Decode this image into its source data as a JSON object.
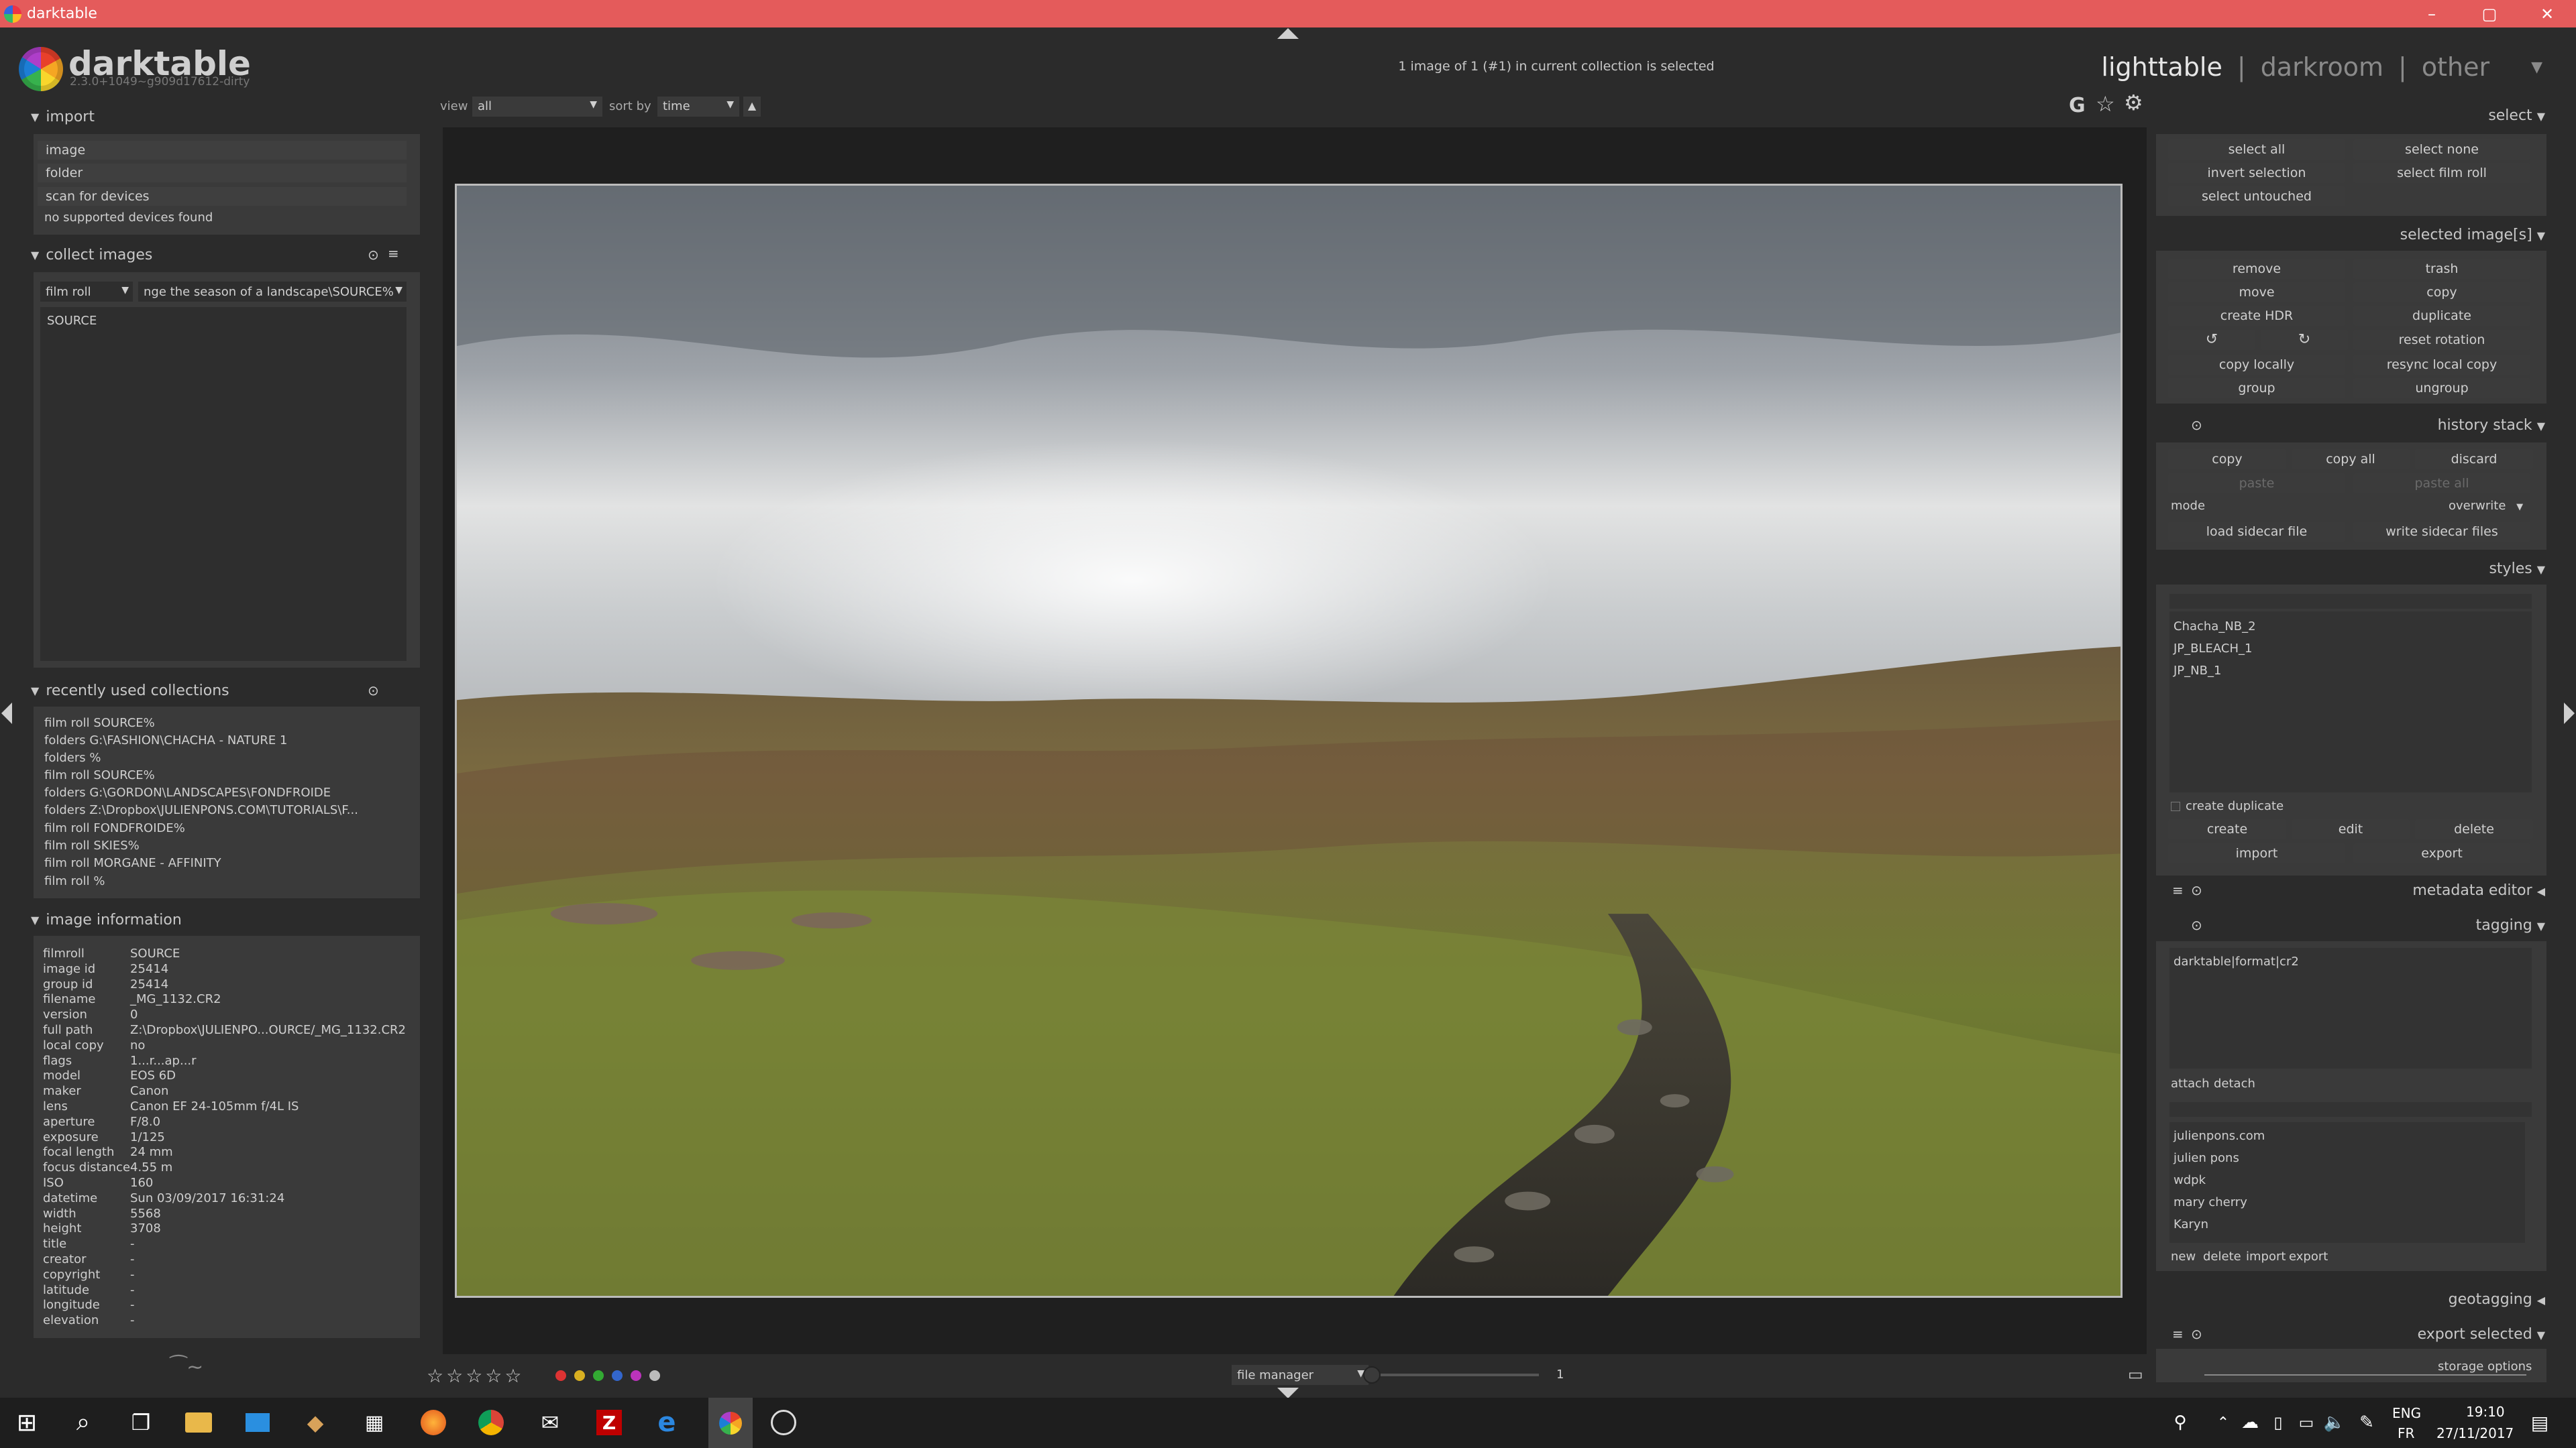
{
  "window": {
    "title": "darktable"
  },
  "header": {
    "logo_name": "darktable",
    "version": "2.3.0+1049~g909d17612-dirty",
    "status": "1 image of 1 (#1) in current collection is selected",
    "views": {
      "lighttable": "lighttable",
      "darkroom": "darkroom",
      "other": "other",
      "sep": "|"
    }
  },
  "toolbar": {
    "view_label": "view",
    "view_value": "all",
    "sort_label": "sort by",
    "sort_value": "time"
  },
  "import": {
    "title": "import",
    "buttons": [
      "image",
      "folder",
      "scan for devices",
      "no supported devices found"
    ]
  },
  "collect": {
    "title": "collect images",
    "property": "film roll",
    "query": "nge the season of a landscape\\SOURCE%",
    "items": [
      "SOURCE"
    ]
  },
  "recent": {
    "title": "recently used collections",
    "items": [
      "film roll SOURCE%",
      "folders G:\\FASHION\\CHACHA - NATURE 1",
      "folders %",
      "film roll SOURCE%",
      "folders G:\\GORDON\\LANDSCAPES\\FONDFROIDE",
      "folders Z:\\Dropbox\\JULIENPONS.COM\\TUTORIALS\\F...",
      "film roll FONDFROIDE%",
      "film roll SKIES%",
      "film roll MORGANE - AFFINITY",
      "film roll %"
    ]
  },
  "info": {
    "title": "image information",
    "rows": [
      [
        "filmroll",
        "SOURCE"
      ],
      [
        "image id",
        "25414"
      ],
      [
        "group id",
        "25414"
      ],
      [
        "filename",
        "_MG_1132.CR2"
      ],
      [
        "version",
        "0"
      ],
      [
        "full path",
        "Z:\\Dropbox\\JULIENPO...OURCE/_MG_1132.CR2"
      ],
      [
        "local copy",
        "no"
      ],
      [
        "flags",
        "1...r...ap...r"
      ],
      [
        "model",
        "EOS 6D"
      ],
      [
        "maker",
        "Canon"
      ],
      [
        "lens",
        "Canon EF 24-105mm f/4L IS"
      ],
      [
        "aperture",
        "F/8.0"
      ],
      [
        "exposure",
        "1/125"
      ],
      [
        "focal length",
        "24 mm"
      ],
      [
        "focus distance",
        "4.55 m"
      ],
      [
        "ISO",
        "160"
      ],
      [
        "datetime",
        "Sun 03/09/2017 16:31:24"
      ],
      [
        "width",
        "5568"
      ],
      [
        "height",
        "3708"
      ],
      [
        "title",
        "-"
      ],
      [
        "creator",
        "-"
      ],
      [
        "copyright",
        "-"
      ],
      [
        "latitude",
        "-"
      ],
      [
        "longitude",
        "-"
      ],
      [
        "elevation",
        "-"
      ]
    ]
  },
  "select": {
    "title": "select",
    "buttons": [
      "select all",
      "select none",
      "invert selection",
      "select film roll",
      "select untouched"
    ]
  },
  "selected": {
    "title": "selected image[s]",
    "buttons": [
      "remove",
      "trash",
      "move",
      "copy",
      "create HDR",
      "duplicate",
      "reset rotation",
      "copy locally",
      "resync local copy",
      "group",
      "ungroup"
    ]
  },
  "history": {
    "title": "history stack",
    "buttons": [
      "copy",
      "copy all",
      "discard",
      "paste",
      "paste all"
    ],
    "mode_label": "mode",
    "mode_value": "overwrite",
    "sidecar": [
      "load sidecar file",
      "write sidecar files"
    ]
  },
  "styles": {
    "title": "styles",
    "items": [
      "Chacha_NB_2",
      "JP_BLEACH_1",
      "JP_NB_1"
    ],
    "create_duplicate": "create duplicate",
    "buttons": [
      "create",
      "edit",
      "delete",
      "import",
      "export"
    ]
  },
  "metadata": {
    "title": "metadata editor"
  },
  "tagging": {
    "title": "tagging",
    "attached": [
      "darktable|format|cr2"
    ],
    "attach": "attach",
    "detach": "detach",
    "dictionary": [
      "julienpons.com",
      "julien pons",
      "wdpk",
      "mary cherry",
      "Karyn"
    ],
    "bottom": [
      "new",
      "delete",
      "import",
      "export"
    ]
  },
  "geotagging": {
    "title": "geotagging"
  },
  "export": {
    "title": "export selected",
    "storage": "storage options"
  },
  "bottombar": {
    "layout": "file manager",
    "zoom": "1",
    "color_labels": [
      "#d33",
      "#d9b021",
      "#3a3",
      "#36c",
      "#b3b",
      "#bbb"
    ]
  },
  "taskbar": {
    "lang1": "ENG",
    "lang2": "FR",
    "time": "19:10",
    "date": "27/11/2017"
  },
  "colors": {
    "titlebar": "#e45b5b",
    "panel": "#333333",
    "button": "#3b3b3b"
  }
}
